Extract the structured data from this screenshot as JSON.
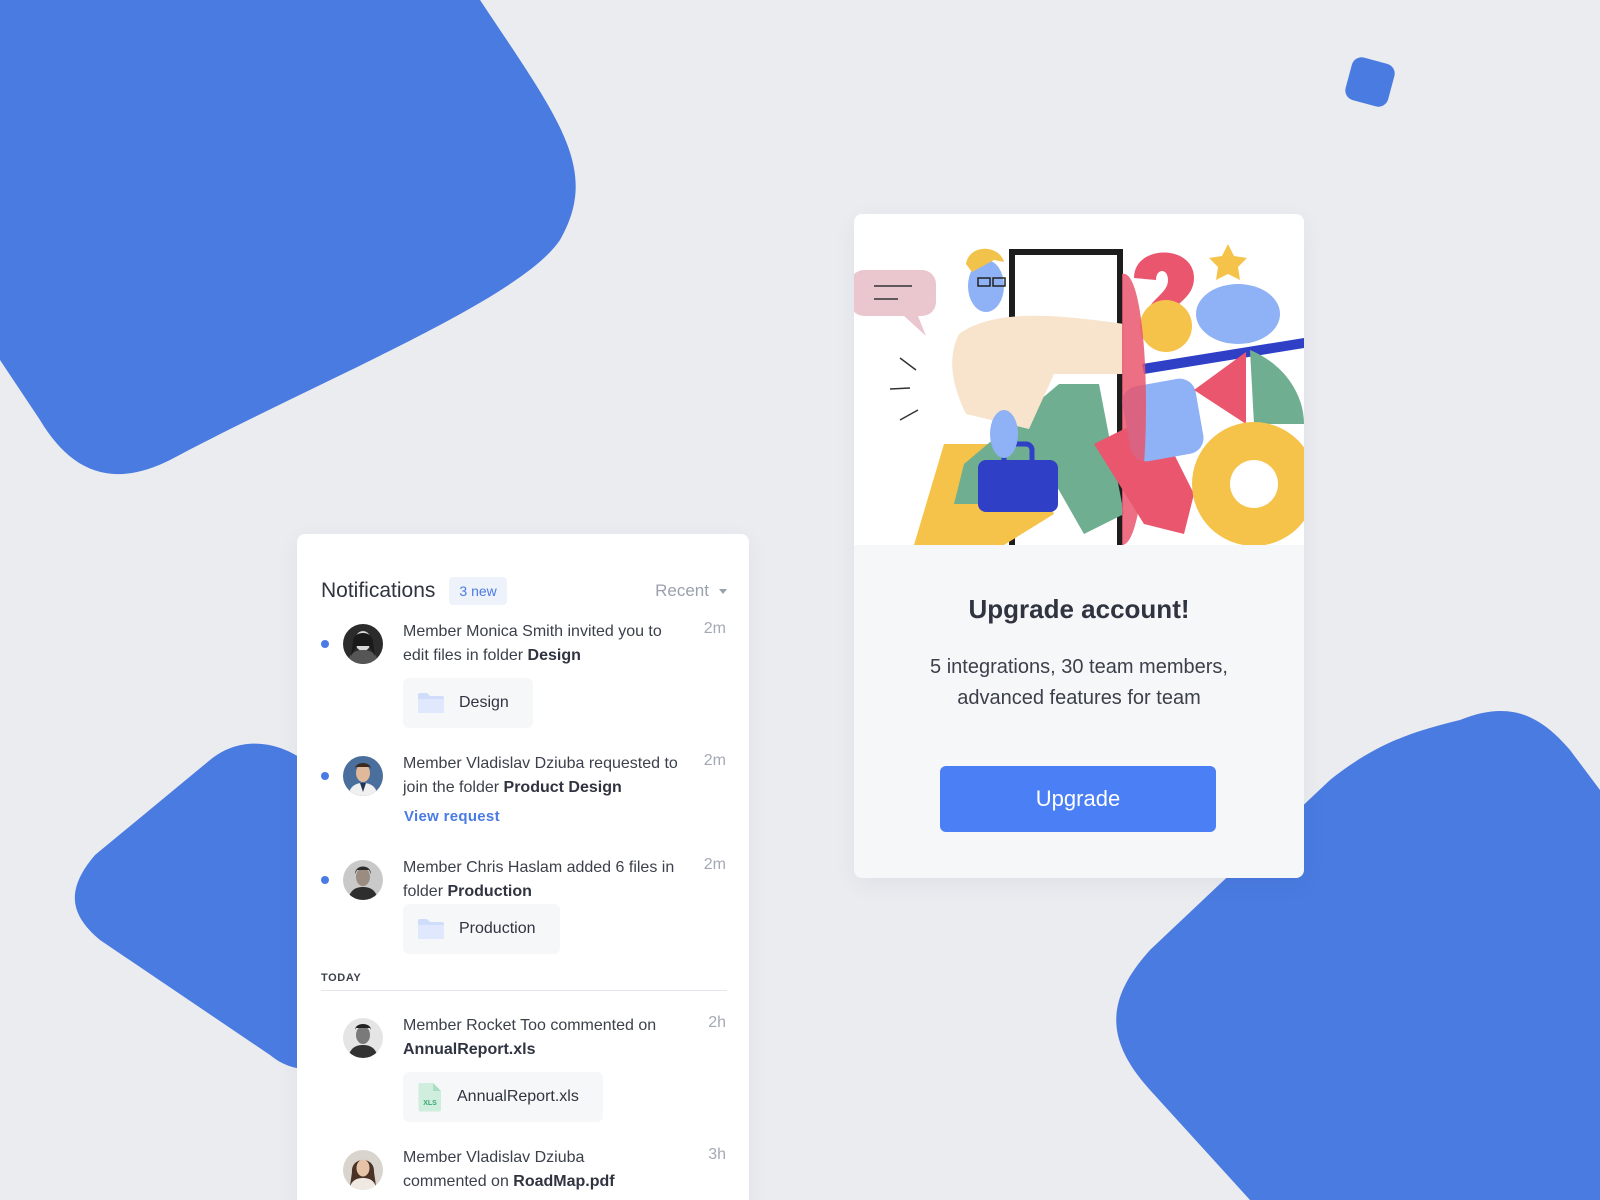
{
  "colors": {
    "background": "#ebecf0",
    "shape_blue": "#4a7be0",
    "accent": "#4a7be5",
    "button": "#4a7ff5"
  },
  "notifications": {
    "title": "Notifications",
    "new_badge": "3 new",
    "sort": {
      "selected": "Recent",
      "icon": "caret-down-icon"
    },
    "items": [
      {
        "unread": true,
        "text_prefix": "Member Monica Smith invited you to edit files in folder ",
        "text_bold": "Design",
        "time": "2m",
        "attachment": {
          "label": "Design",
          "icon": "folder-icon"
        }
      },
      {
        "unread": true,
        "text_prefix": "Member Vladislav Dziuba requested to join the folder ",
        "text_bold": "Product Design",
        "time": "2m",
        "link": "View request"
      },
      {
        "unread": true,
        "text_prefix": "Member Chris Haslam added 6 files in folder ",
        "text_bold": "Production",
        "time": "2m",
        "attachment": {
          "label": "Production",
          "icon": "folder-icon"
        }
      }
    ],
    "section_today": "TODAY",
    "today_items": [
      {
        "unread": false,
        "text_prefix": "Member Rocket Too commented on ",
        "text_bold": "AnnualReport.xls",
        "time": "2h",
        "attachment": {
          "label": "AnnualReport.xls",
          "icon": "xls-file-icon",
          "icon_text": "XLS"
        }
      },
      {
        "unread": false,
        "text_prefix": "Member Vladislav Dziuba commented on ",
        "text_bold": "RoadMap.pdf",
        "time": "3h"
      }
    ]
  },
  "upgrade": {
    "title": "Upgrade account!",
    "description": "5 integrations, 30 team members, advanced features for team",
    "button": "Upgrade"
  }
}
